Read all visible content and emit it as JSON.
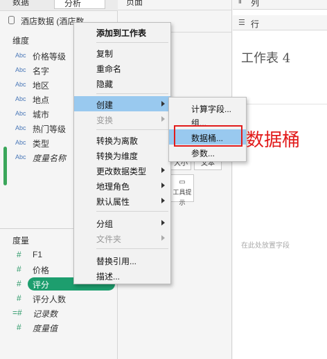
{
  "data_pane": {
    "tab_label": "数据",
    "analysis_tab": "分析",
    "datasource": "酒店数据 (酒店数",
    "dimensions_title": "维度",
    "dimensions": [
      {
        "type": "Abc",
        "name": "价格等级",
        "italic": false
      },
      {
        "type": "Abc",
        "name": "名字",
        "italic": false
      },
      {
        "type": "Abc",
        "name": "地区",
        "italic": false
      },
      {
        "type": "Abc",
        "name": "地点",
        "italic": false
      },
      {
        "type": "Abc",
        "name": "城市",
        "italic": false
      },
      {
        "type": "Abc",
        "name": "热门等级",
        "italic": false
      },
      {
        "type": "Abc",
        "name": "类型",
        "italic": false
      },
      {
        "type": "Abc",
        "name": "度量名称",
        "italic": true
      }
    ],
    "measures_title": "度量",
    "measures": [
      {
        "type": "#",
        "name": "F1",
        "italic": false,
        "selected": false
      },
      {
        "type": "#",
        "name": "价格",
        "italic": false,
        "selected": false
      },
      {
        "type": "#",
        "name": "评分",
        "italic": false,
        "selected": true
      },
      {
        "type": "#",
        "name": "评分人数",
        "italic": false,
        "selected": false
      },
      {
        "type": "=#",
        "name": "记录数",
        "italic": true,
        "selected": false
      },
      {
        "type": "#",
        "name": "度量值",
        "italic": true,
        "selected": false
      }
    ]
  },
  "pages_label": "页面",
  "marks": {
    "size_label": "大小",
    "text_label": "文本",
    "tooltip_label": "工具提示"
  },
  "shelves": {
    "columns_label": "列",
    "rows_label": "行"
  },
  "sheet_title": "工作表 4",
  "drop_hint": "在此处放置字段",
  "context_menu": {
    "items": [
      {
        "label": "添加到工作表",
        "bold": true
      },
      {
        "label": "复制"
      },
      {
        "label": "重命名"
      },
      {
        "label": "隐藏"
      },
      {
        "label": "创建",
        "submenu": true,
        "highlighted": true
      },
      {
        "label": "变换",
        "submenu": true,
        "disabled": true
      },
      {
        "label": "转换为离散"
      },
      {
        "label": "转换为维度"
      },
      {
        "label": "更改数据类型",
        "submenu": true
      },
      {
        "label": "地理角色",
        "submenu": true
      },
      {
        "label": "默认属性",
        "submenu": true
      },
      {
        "label": "分组",
        "submenu": true
      },
      {
        "label": "文件夹",
        "submenu": true,
        "disabled": true
      },
      {
        "label": "替换引用..."
      },
      {
        "label": "描述..."
      }
    ]
  },
  "create_submenu": {
    "items": [
      {
        "label": "计算字段..."
      },
      {
        "label": "组..."
      },
      {
        "label": "数据桶...",
        "highlighted": true
      },
      {
        "label": "参数..."
      }
    ]
  },
  "annotation": {
    "text": "数据桶",
    "color": "#e21b1b"
  }
}
